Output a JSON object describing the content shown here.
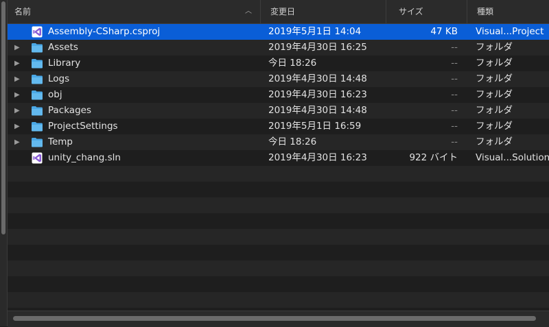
{
  "columns": {
    "name": "名前",
    "date": "変更日",
    "size": "サイズ",
    "kind": "種類"
  },
  "files": [
    {
      "name": "Assembly-CSharp.csproj",
      "date": "2019年5月1日 14:04",
      "size": "47 KB",
      "kind": "Visual...Project",
      "type": "vs-project",
      "expandable": false,
      "selected": true
    },
    {
      "name": "Assets",
      "date": "2019年4月30日 16:25",
      "size": "--",
      "kind": "フォルダ",
      "type": "folder",
      "expandable": true
    },
    {
      "name": "Library",
      "date": "今日 18:26",
      "size": "--",
      "kind": "フォルダ",
      "type": "folder",
      "expandable": true
    },
    {
      "name": "Logs",
      "date": "2019年4月30日 14:48",
      "size": "--",
      "kind": "フォルダ",
      "type": "folder",
      "expandable": true
    },
    {
      "name": "obj",
      "date": "2019年4月30日 16:23",
      "size": "--",
      "kind": "フォルダ",
      "type": "folder",
      "expandable": true
    },
    {
      "name": "Packages",
      "date": "2019年4月30日 14:48",
      "size": "--",
      "kind": "フォルダ",
      "type": "folder",
      "expandable": true
    },
    {
      "name": "ProjectSettings",
      "date": "2019年5月1日 16:59",
      "size": "--",
      "kind": "フォルダ",
      "type": "folder",
      "expandable": true
    },
    {
      "name": "Temp",
      "date": "今日 18:26",
      "size": "--",
      "kind": "フォルダ",
      "type": "folder",
      "expandable": true
    },
    {
      "name": "unity_chang.sln",
      "date": "2019年4月30日 16:23",
      "size": "922 バイト",
      "kind": "Visual...Solution",
      "type": "vs-solution",
      "expandable": false
    }
  ],
  "colors": {
    "selection": "#0a5ed7",
    "folder": "#4aa8e6",
    "vs_icon": "#8a5cd6"
  }
}
